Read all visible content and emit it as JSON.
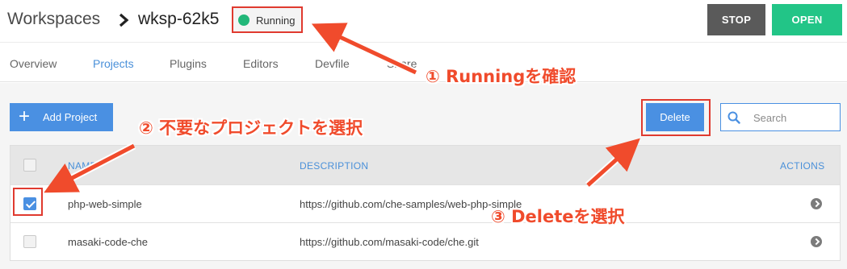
{
  "header": {
    "breadcrumb_root": "Workspaces",
    "workspace_name": "wksp-62k5",
    "status": {
      "label": "Running",
      "color": "#22b779"
    },
    "stop_label": "STOP",
    "open_label": "OPEN"
  },
  "tabs": [
    {
      "label": "Overview",
      "active": false
    },
    {
      "label": "Projects",
      "active": true
    },
    {
      "label": "Plugins",
      "active": false
    },
    {
      "label": "Editors",
      "active": false
    },
    {
      "label": "Devfile",
      "active": false
    },
    {
      "label": "Share",
      "active": false
    }
  ],
  "toolbar": {
    "add_project_label": "Add Project",
    "delete_label": "Delete",
    "search_placeholder": "Search"
  },
  "table": {
    "columns": [
      "NAME",
      "DESCRIPTION",
      "ACTIONS"
    ],
    "rows": [
      {
        "checked": true,
        "name": "php-web-simple",
        "description": "https://github.com/che-samples/web-php-simple"
      },
      {
        "checked": false,
        "name": "masaki-code-che",
        "description": "https://github.com/masaki-code/che.git"
      }
    ]
  },
  "annotations": {
    "step1": "① Runningを確認",
    "step2": "② 不要なプロジェクトを選択",
    "step3": "③ Deleteを選択"
  },
  "colors": {
    "accent": "#4a90e2",
    "open": "#22c587",
    "stop": "#5a5a5a",
    "annotation": "#f04b2c"
  }
}
